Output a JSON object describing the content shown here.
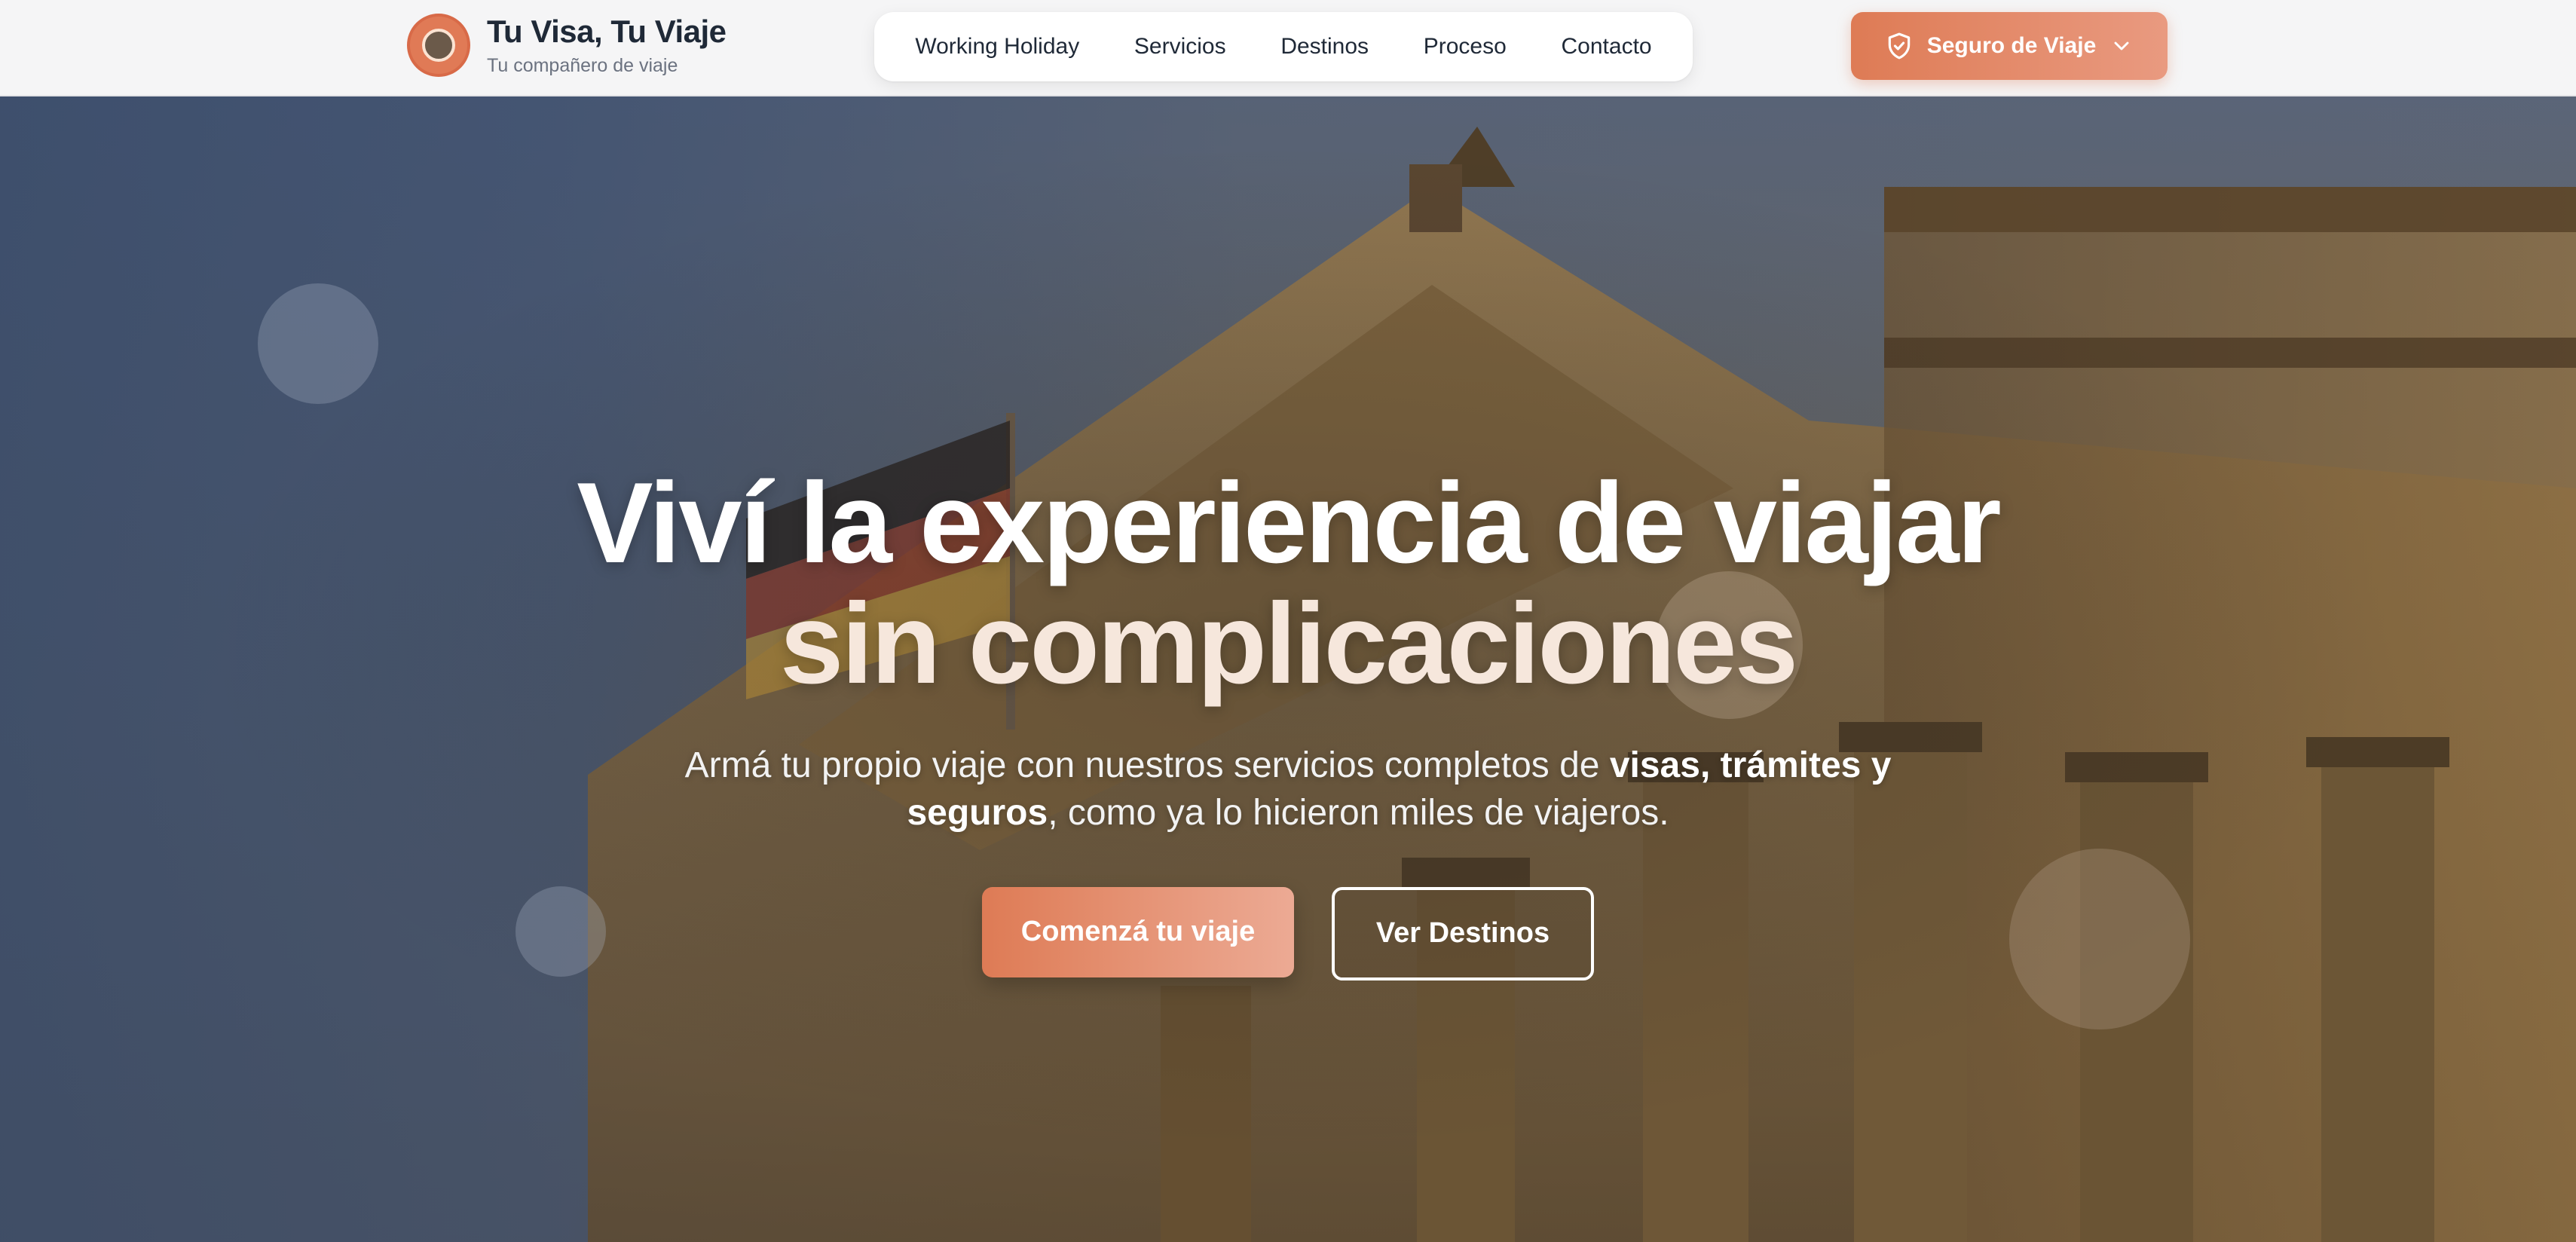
{
  "brand": {
    "title": "Tu Visa, Tu Viaje",
    "subtitle": "Tu compañero de viaje",
    "logo_icon": "brand-logo-icon"
  },
  "nav": {
    "items": [
      {
        "label": "Working Holiday"
      },
      {
        "label": "Servicios"
      },
      {
        "label": "Destinos"
      },
      {
        "label": "Proceso"
      },
      {
        "label": "Contacto"
      }
    ]
  },
  "header_cta": {
    "label": "Seguro de Viaje",
    "icon": "shield-check-icon",
    "trailing_icon": "chevron-down-icon"
  },
  "hero": {
    "headline_line1": "Viví la experiencia de viajar",
    "headline_line2": "sin complicaciones",
    "subtext_part1": "Armá tu propio viaje con nuestros servicios completos de ",
    "subtext_bold": "visas, trámites y seguros",
    "subtext_part2": ", como ya lo hicieron miles de viajeros.",
    "primary_button": "Comenzá tu viaje",
    "secondary_button": "Ver Destinos"
  },
  "colors": {
    "accent": "#de7b55",
    "accent_light": "#ecaa94",
    "text_dark": "#1f2937",
    "text_muted": "#6b7280"
  }
}
